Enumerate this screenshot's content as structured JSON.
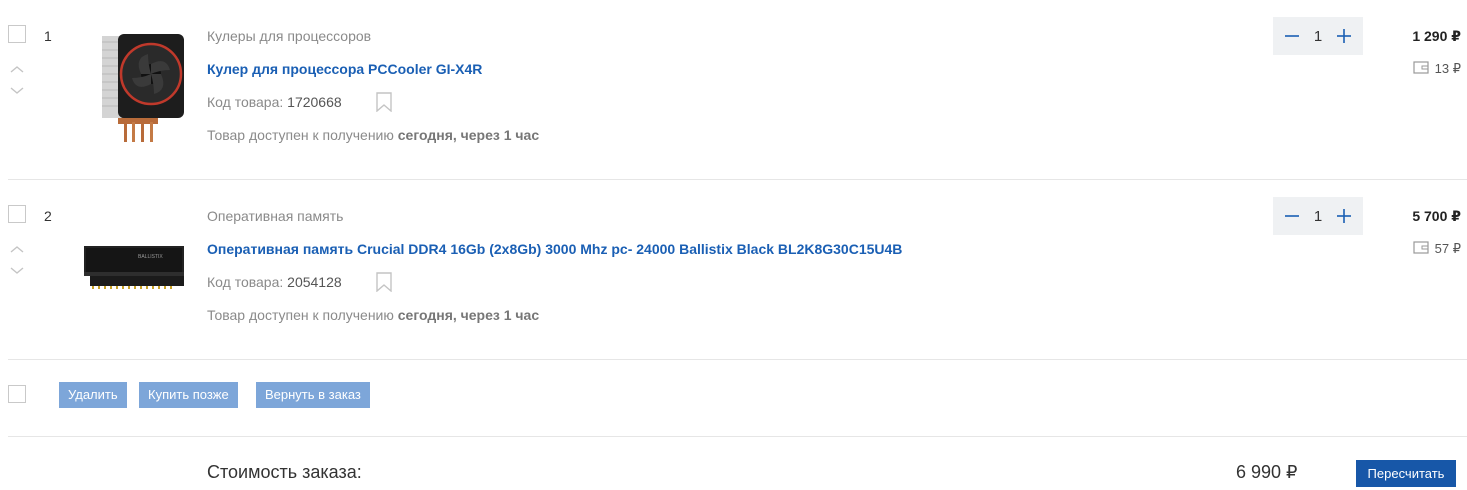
{
  "currency_symbol": "₽",
  "items": [
    {
      "number": "1",
      "category": "Кулеры для процессоров",
      "title": "Кулер для процессора PCCooler GI-X4R",
      "code_label": "Код товара:",
      "code": "1720668",
      "availability_text": "Товар доступен к получению",
      "availability_bold": "сегодня, через 1 час",
      "quantity": "1",
      "price": "1 290 ₽",
      "bonus": "13 ₽",
      "image_icon": "cpu-cooler-image"
    },
    {
      "number": "2",
      "category": "Оперативная память",
      "title": "Оперативная память Crucial DDR4 16Gb (2x8Gb) 3000 Mhz pc- 24000 Ballistix Black BL2K8G30C15U4B",
      "code_label": "Код товара:",
      "code": "2054128",
      "availability_text": "Товар доступен к получению",
      "availability_bold": "сегодня, через 1 час",
      "quantity": "1",
      "price": "5 700 ₽",
      "bonus": "57 ₽",
      "image_icon": "ram-module-image",
      "image_label": "BALLISTIX"
    }
  ],
  "actions": {
    "delete": "Удалить",
    "buy_later": "Купить позже",
    "return_to_order": "Вернуть в заказ"
  },
  "summary": {
    "label": "Стоимость заказа:",
    "value": "6 990 ₽",
    "recalc_button": "Пересчитать"
  },
  "colors": {
    "link": "#1a5fb4",
    "action_button": "#7da6d9",
    "primary_button": "#1757a8",
    "stepper_bg": "#eff1f3"
  }
}
